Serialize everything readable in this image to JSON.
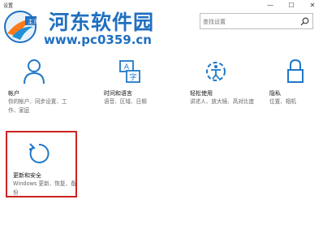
{
  "window": {
    "title": "设置",
    "minimize_glyph": "—",
    "maximize_glyph": "☐",
    "close_glyph": "✕"
  },
  "watermark": {
    "title": "河东软件园",
    "url": "www.pc0359.cn",
    "home_label": "主页"
  },
  "search": {
    "placeholder": "查找设置",
    "icon": "search-icon"
  },
  "tiles": [
    {
      "icon": "person-icon",
      "name": "帐户",
      "desc": "你的帐户、同步设置、工作、家庭"
    },
    {
      "icon": "time-language-icon",
      "name": "时间和语言",
      "desc": "语音、区域、日期"
    },
    {
      "icon": "ease-of-access-icon",
      "name": "轻松使用",
      "desc": "讲述人、放大镜、高对比度"
    },
    {
      "icon": "lock-icon",
      "name": "隐私",
      "desc": "位置、相机"
    },
    {
      "icon": "update-icon",
      "name": "更新和安全",
      "desc": "Windows 更新、恢复、备份"
    }
  ],
  "colors": {
    "accent": "#1f78c8",
    "highlight": "#cc2222",
    "watermark": "#1f6fc0"
  }
}
